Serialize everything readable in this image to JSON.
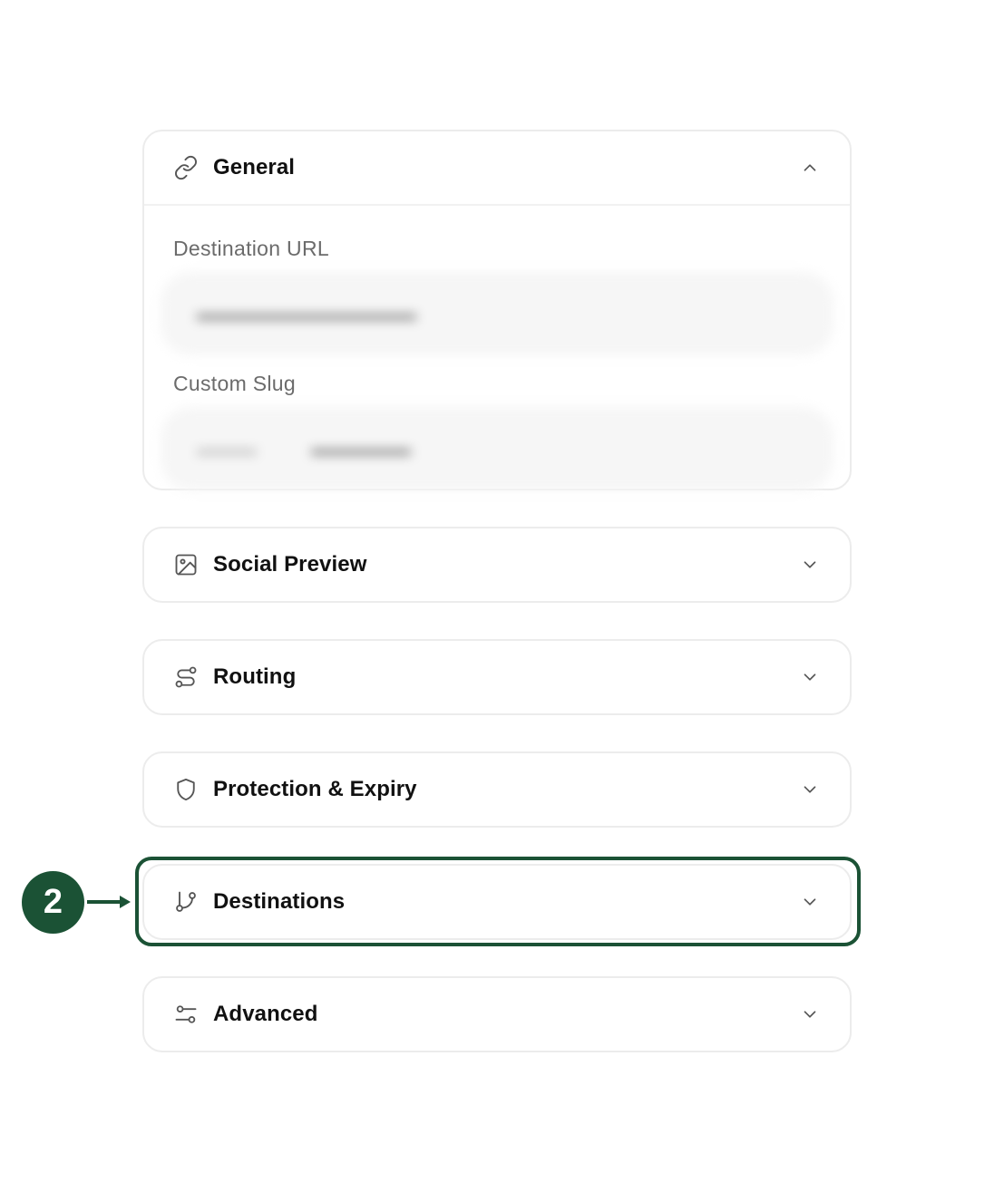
{
  "sections": {
    "general": {
      "title": "General",
      "icon": "link-icon",
      "expanded": true,
      "fields": {
        "destination_url_label": "Destination URL",
        "custom_slug_label": "Custom Slug"
      }
    },
    "social_preview": {
      "title": "Social Preview",
      "icon": "image-icon"
    },
    "routing": {
      "title": "Routing",
      "icon": "route-icon"
    },
    "protection": {
      "title": "Protection & Expiry",
      "icon": "shield-icon"
    },
    "destinations": {
      "title": "Destinations",
      "icon": "git-branch-icon"
    },
    "advanced": {
      "title": "Advanced",
      "icon": "sliders-icon"
    }
  },
  "annotation": {
    "step_number": "2",
    "color": "#1b5235"
  },
  "colors": {
    "border": "#ececec",
    "label": "#6b6b6b",
    "title": "#111111"
  }
}
